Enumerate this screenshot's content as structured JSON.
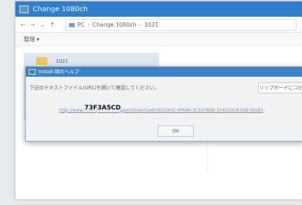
{
  "window": {
    "title": "Change 1080ch"
  },
  "nav": {
    "back": "←",
    "forward": "→",
    "recent": "⌄",
    "up": "↑"
  },
  "address": {
    "segments": [
      "PC",
      "Change 1080ch",
      "1021"
    ],
    "separator": "›"
  },
  "toolbar": {
    "menu_label": "整理 ▾"
  },
  "folder": {
    "name": "1021"
  },
  "dialog": {
    "title": "Install 時のヘルプ",
    "message": "下記のテキストファイル(URL)を開いて確認してください。",
    "clipboard_button": "クリップボードにコピー",
    "link_text": "http://www.example.com/support/download/1021/A31-0F69A-3C2D7B6E-5F4210C8-D9E7A1B3",
    "link_label": "73F3A5CD",
    "ok_button": "OK"
  },
  "colors": {
    "titlebar": "#2f7fcf",
    "dialog_titlebar": "#3b83c9",
    "link": "#6d89c7",
    "folder": "#f1c75a"
  }
}
